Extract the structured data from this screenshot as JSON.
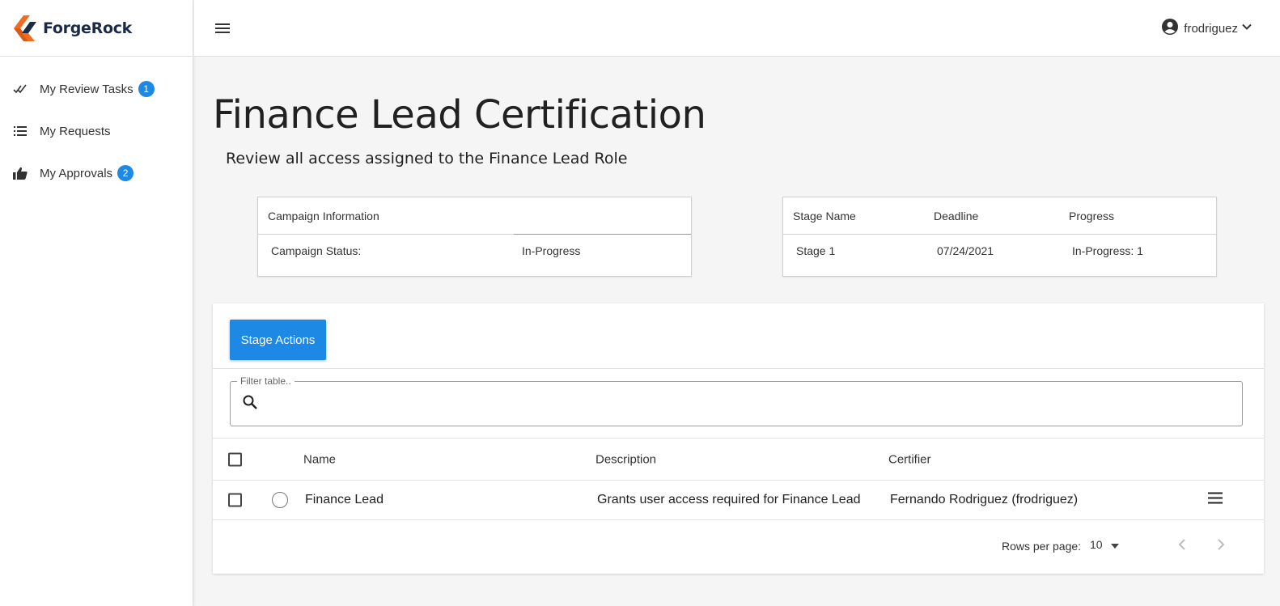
{
  "app": {
    "brand": "ForgeRock"
  },
  "sidebar": {
    "items": [
      {
        "label": "My Review Tasks",
        "icon": "double-check-icon",
        "badge": "1"
      },
      {
        "label": "My Requests",
        "icon": "list-icon",
        "badge": null
      },
      {
        "label": "My Approvals",
        "icon": "thumbs-up-icon",
        "badge": "2"
      }
    ]
  },
  "topbar": {
    "username": "frodriguez"
  },
  "page": {
    "title": "Finance Lead Certification",
    "subtitle": "Review all access assigned to the Finance Lead Role"
  },
  "campaign_info": {
    "header": "Campaign Information",
    "status_label": "Campaign Status:",
    "status_value": "In-Progress"
  },
  "stage_info": {
    "headers": [
      "Stage Name",
      "Deadline",
      "Progress"
    ],
    "row": [
      "Stage 1",
      "07/24/2021",
      "In-Progress: 1"
    ]
  },
  "actions": {
    "stage_actions_label": "Stage Actions"
  },
  "filter": {
    "label": "Filter table..",
    "value": ""
  },
  "table": {
    "columns": [
      "Name",
      "Description",
      "Certifier"
    ],
    "rows": [
      {
        "name": "Finance Lead",
        "description": "Grants user access required for Finance Lead",
        "certifier": "Fernando Rodriguez (frodriguez)"
      }
    ]
  },
  "pagination": {
    "rows_per_page_label": "Rows per page:",
    "rows_per_page_value": "10"
  },
  "colors": {
    "accent": "#1e88e5",
    "brand_orange": "#f26b21",
    "brand_navy": "#1b2a47"
  }
}
